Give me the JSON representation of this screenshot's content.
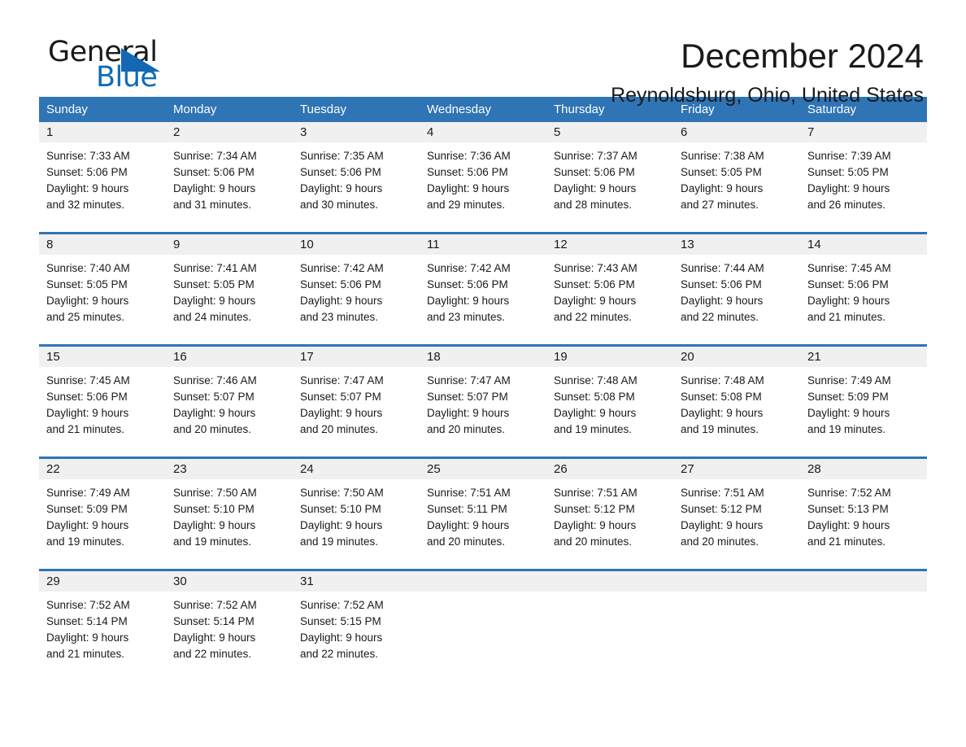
{
  "brand": {
    "name_part1": "General",
    "name_part2": "Blue",
    "accent_color": "#0f6cb8",
    "triangle_icon": "triangle-icon"
  },
  "header": {
    "title": "December 2024",
    "subtitle": "Reynoldsburg, Ohio, United States"
  },
  "calendar": {
    "header_bg": "#2f74b5",
    "daynum_bg": "#f0f0f0",
    "weekdays": [
      "Sunday",
      "Monday",
      "Tuesday",
      "Wednesday",
      "Thursday",
      "Friday",
      "Saturday"
    ],
    "weeks": [
      [
        {
          "day": "1",
          "sunrise": "Sunrise: 7:33 AM",
          "sunset": "Sunset: 5:06 PM",
          "daylight_l1": "Daylight: 9 hours",
          "daylight_l2": "and 32 minutes."
        },
        {
          "day": "2",
          "sunrise": "Sunrise: 7:34 AM",
          "sunset": "Sunset: 5:06 PM",
          "daylight_l1": "Daylight: 9 hours",
          "daylight_l2": "and 31 minutes."
        },
        {
          "day": "3",
          "sunrise": "Sunrise: 7:35 AM",
          "sunset": "Sunset: 5:06 PM",
          "daylight_l1": "Daylight: 9 hours",
          "daylight_l2": "and 30 minutes."
        },
        {
          "day": "4",
          "sunrise": "Sunrise: 7:36 AM",
          "sunset": "Sunset: 5:06 PM",
          "daylight_l1": "Daylight: 9 hours",
          "daylight_l2": "and 29 minutes."
        },
        {
          "day": "5",
          "sunrise": "Sunrise: 7:37 AM",
          "sunset": "Sunset: 5:06 PM",
          "daylight_l1": "Daylight: 9 hours",
          "daylight_l2": "and 28 minutes."
        },
        {
          "day": "6",
          "sunrise": "Sunrise: 7:38 AM",
          "sunset": "Sunset: 5:05 PM",
          "daylight_l1": "Daylight: 9 hours",
          "daylight_l2": "and 27 minutes."
        },
        {
          "day": "7",
          "sunrise": "Sunrise: 7:39 AM",
          "sunset": "Sunset: 5:05 PM",
          "daylight_l1": "Daylight: 9 hours",
          "daylight_l2": "and 26 minutes."
        }
      ],
      [
        {
          "day": "8",
          "sunrise": "Sunrise: 7:40 AM",
          "sunset": "Sunset: 5:05 PM",
          "daylight_l1": "Daylight: 9 hours",
          "daylight_l2": "and 25 minutes."
        },
        {
          "day": "9",
          "sunrise": "Sunrise: 7:41 AM",
          "sunset": "Sunset: 5:05 PM",
          "daylight_l1": "Daylight: 9 hours",
          "daylight_l2": "and 24 minutes."
        },
        {
          "day": "10",
          "sunrise": "Sunrise: 7:42 AM",
          "sunset": "Sunset: 5:06 PM",
          "daylight_l1": "Daylight: 9 hours",
          "daylight_l2": "and 23 minutes."
        },
        {
          "day": "11",
          "sunrise": "Sunrise: 7:42 AM",
          "sunset": "Sunset: 5:06 PM",
          "daylight_l1": "Daylight: 9 hours",
          "daylight_l2": "and 23 minutes."
        },
        {
          "day": "12",
          "sunrise": "Sunrise: 7:43 AM",
          "sunset": "Sunset: 5:06 PM",
          "daylight_l1": "Daylight: 9 hours",
          "daylight_l2": "and 22 minutes."
        },
        {
          "day": "13",
          "sunrise": "Sunrise: 7:44 AM",
          "sunset": "Sunset: 5:06 PM",
          "daylight_l1": "Daylight: 9 hours",
          "daylight_l2": "and 22 minutes."
        },
        {
          "day": "14",
          "sunrise": "Sunrise: 7:45 AM",
          "sunset": "Sunset: 5:06 PM",
          "daylight_l1": "Daylight: 9 hours",
          "daylight_l2": "and 21 minutes."
        }
      ],
      [
        {
          "day": "15",
          "sunrise": "Sunrise: 7:45 AM",
          "sunset": "Sunset: 5:06 PM",
          "daylight_l1": "Daylight: 9 hours",
          "daylight_l2": "and 21 minutes."
        },
        {
          "day": "16",
          "sunrise": "Sunrise: 7:46 AM",
          "sunset": "Sunset: 5:07 PM",
          "daylight_l1": "Daylight: 9 hours",
          "daylight_l2": "and 20 minutes."
        },
        {
          "day": "17",
          "sunrise": "Sunrise: 7:47 AM",
          "sunset": "Sunset: 5:07 PM",
          "daylight_l1": "Daylight: 9 hours",
          "daylight_l2": "and 20 minutes."
        },
        {
          "day": "18",
          "sunrise": "Sunrise: 7:47 AM",
          "sunset": "Sunset: 5:07 PM",
          "daylight_l1": "Daylight: 9 hours",
          "daylight_l2": "and 20 minutes."
        },
        {
          "day": "19",
          "sunrise": "Sunrise: 7:48 AM",
          "sunset": "Sunset: 5:08 PM",
          "daylight_l1": "Daylight: 9 hours",
          "daylight_l2": "and 19 minutes."
        },
        {
          "day": "20",
          "sunrise": "Sunrise: 7:48 AM",
          "sunset": "Sunset: 5:08 PM",
          "daylight_l1": "Daylight: 9 hours",
          "daylight_l2": "and 19 minutes."
        },
        {
          "day": "21",
          "sunrise": "Sunrise: 7:49 AM",
          "sunset": "Sunset: 5:09 PM",
          "daylight_l1": "Daylight: 9 hours",
          "daylight_l2": "and 19 minutes."
        }
      ],
      [
        {
          "day": "22",
          "sunrise": "Sunrise: 7:49 AM",
          "sunset": "Sunset: 5:09 PM",
          "daylight_l1": "Daylight: 9 hours",
          "daylight_l2": "and 19 minutes."
        },
        {
          "day": "23",
          "sunrise": "Sunrise: 7:50 AM",
          "sunset": "Sunset: 5:10 PM",
          "daylight_l1": "Daylight: 9 hours",
          "daylight_l2": "and 19 minutes."
        },
        {
          "day": "24",
          "sunrise": "Sunrise: 7:50 AM",
          "sunset": "Sunset: 5:10 PM",
          "daylight_l1": "Daylight: 9 hours",
          "daylight_l2": "and 19 minutes."
        },
        {
          "day": "25",
          "sunrise": "Sunrise: 7:51 AM",
          "sunset": "Sunset: 5:11 PM",
          "daylight_l1": "Daylight: 9 hours",
          "daylight_l2": "and 20 minutes."
        },
        {
          "day": "26",
          "sunrise": "Sunrise: 7:51 AM",
          "sunset": "Sunset: 5:12 PM",
          "daylight_l1": "Daylight: 9 hours",
          "daylight_l2": "and 20 minutes."
        },
        {
          "day": "27",
          "sunrise": "Sunrise: 7:51 AM",
          "sunset": "Sunset: 5:12 PM",
          "daylight_l1": "Daylight: 9 hours",
          "daylight_l2": "and 20 minutes."
        },
        {
          "day": "28",
          "sunrise": "Sunrise: 7:52 AM",
          "sunset": "Sunset: 5:13 PM",
          "daylight_l1": "Daylight: 9 hours",
          "daylight_l2": "and 21 minutes."
        }
      ],
      [
        {
          "day": "29",
          "sunrise": "Sunrise: 7:52 AM",
          "sunset": "Sunset: 5:14 PM",
          "daylight_l1": "Daylight: 9 hours",
          "daylight_l2": "and 21 minutes."
        },
        {
          "day": "30",
          "sunrise": "Sunrise: 7:52 AM",
          "sunset": "Sunset: 5:14 PM",
          "daylight_l1": "Daylight: 9 hours",
          "daylight_l2": "and 22 minutes."
        },
        {
          "day": "31",
          "sunrise": "Sunrise: 7:52 AM",
          "sunset": "Sunset: 5:15 PM",
          "daylight_l1": "Daylight: 9 hours",
          "daylight_l2": "and 22 minutes."
        },
        {
          "day": "",
          "sunrise": "",
          "sunset": "",
          "daylight_l1": "",
          "daylight_l2": ""
        },
        {
          "day": "",
          "sunrise": "",
          "sunset": "",
          "daylight_l1": "",
          "daylight_l2": ""
        },
        {
          "day": "",
          "sunrise": "",
          "sunset": "",
          "daylight_l1": "",
          "daylight_l2": ""
        },
        {
          "day": "",
          "sunrise": "",
          "sunset": "",
          "daylight_l1": "",
          "daylight_l2": ""
        }
      ]
    ]
  }
}
